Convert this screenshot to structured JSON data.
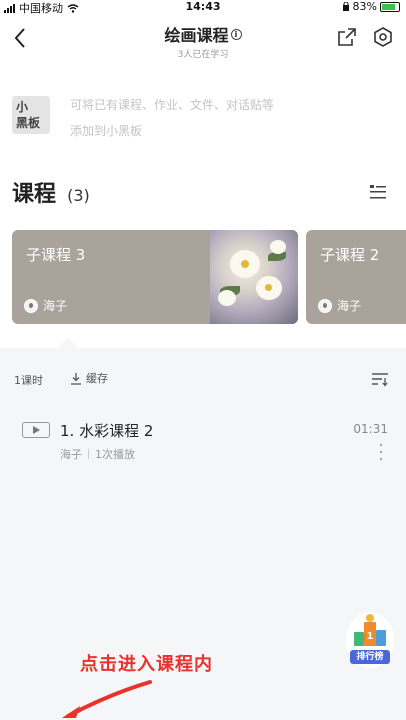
{
  "status_bar": {
    "carrier": "中国移动",
    "time": "14:43",
    "battery": "83%"
  },
  "header": {
    "title": "绘画课程",
    "subtitle": "3人已在学习"
  },
  "blackboard": {
    "badge": "小黑板",
    "badge_line1": "小",
    "badge_line2": "黑板",
    "line1": "可将已有课程、作业、文件、对话贴等",
    "line2": "添加到小黑板"
  },
  "courses": {
    "title": "课程",
    "count": "(3)",
    "cards": [
      {
        "title": "子课程 3",
        "author": "海子"
      },
      {
        "title": "子课程 2",
        "author": "海子"
      }
    ]
  },
  "lessons": {
    "count_label": "1课时",
    "cache_label": "缓存",
    "items": [
      {
        "title": "1. 水彩课程 2",
        "author": "海子",
        "plays": "1次播放",
        "duration": "01:31"
      }
    ]
  },
  "rank_button": {
    "label": "排行榜",
    "rank": "1"
  },
  "annotation": {
    "text": "点击进入课程内"
  },
  "colors": {
    "card_bg": "#aaa39c",
    "panel_bg": "#f5f6f8",
    "annotation": "#e8322b",
    "rank_accent": "#4a68d8"
  },
  "icons": {
    "back": "back-chevron-icon",
    "share": "share-icon",
    "settings": "hexagon-gear-icon",
    "list_view": "list-view-icon",
    "download": "download-icon",
    "sort": "sort-icon",
    "play": "play-icon",
    "more": "more-vertical-icon"
  }
}
